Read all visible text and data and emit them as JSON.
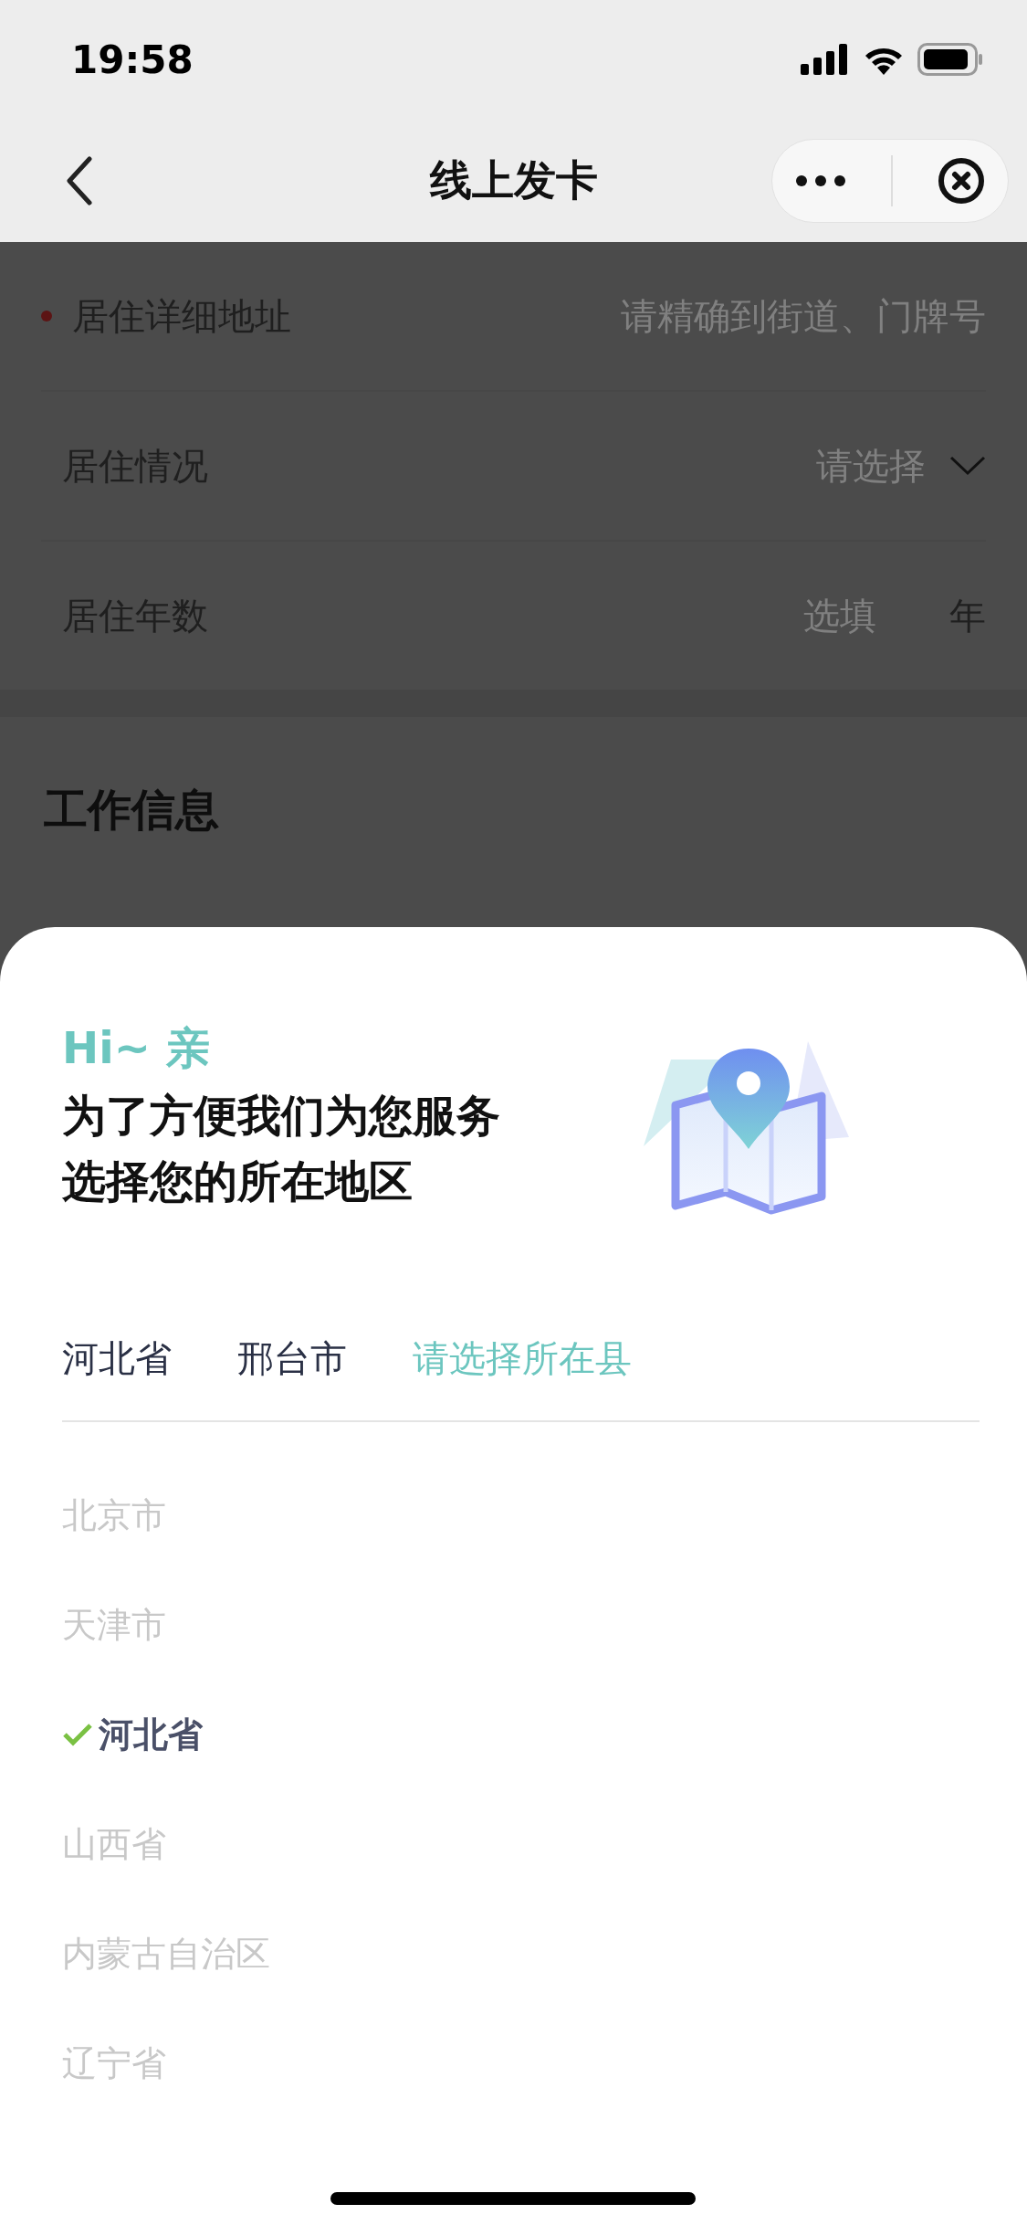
{
  "status_bar": {
    "time": "19:58"
  },
  "nav_bar": {
    "title": "线上发卡"
  },
  "form_rows": [
    {
      "kind": "text",
      "required": true,
      "label": "居住详细地址",
      "placeholder": "请精确到街道、门牌号"
    },
    {
      "kind": "select",
      "required": false,
      "label": "居住情况",
      "placeholder": "请选择"
    },
    {
      "kind": "unit",
      "required": false,
      "label": "居住年数",
      "placeholder": "选填",
      "unit": "年"
    }
  ],
  "section": {
    "title": "工作信息"
  },
  "region_sheet": {
    "greeting": "Hi~ 亲",
    "title_lines": [
      "为了方便我们为您服务",
      "选择您的所在地区"
    ],
    "tabs": [
      {
        "label": "河北省",
        "selected": false
      },
      {
        "label": "邢台市",
        "selected": false
      },
      {
        "label": "请选择所在县",
        "selected": true
      }
    ],
    "options": [
      {
        "label": "北京市",
        "selected": false
      },
      {
        "label": "天津市",
        "selected": false
      },
      {
        "label": "河北省",
        "selected": true
      },
      {
        "label": "山西省",
        "selected": false
      },
      {
        "label": "内蒙古自治区",
        "selected": false
      },
      {
        "label": "辽宁省",
        "selected": false
      }
    ]
  }
}
